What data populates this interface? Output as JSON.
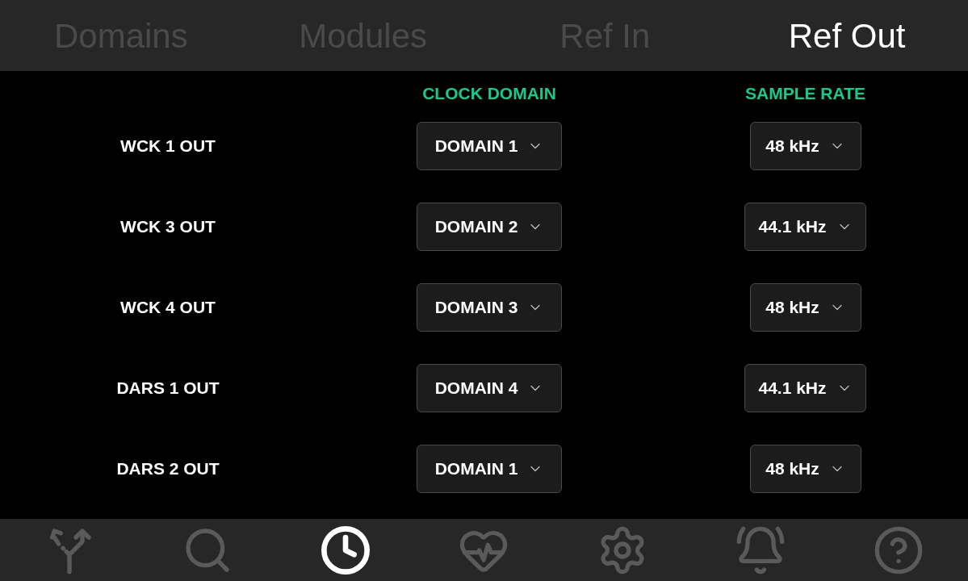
{
  "tabs": [
    {
      "label": "Domains",
      "selected": false
    },
    {
      "label": "Modules",
      "selected": false
    },
    {
      "label": "Ref In",
      "selected": false
    },
    {
      "label": "Ref Out",
      "selected": true
    }
  ],
  "table": {
    "columns": [
      "CLOCK DOMAIN",
      "SAMPLE RATE"
    ],
    "rows": [
      {
        "label": "WCK 1 OUT",
        "clock_domain": "DOMAIN 1",
        "sample_rate": "48 kHz"
      },
      {
        "label": "WCK 3 OUT",
        "clock_domain": "DOMAIN 2",
        "sample_rate": "44.1 kHz"
      },
      {
        "label": "WCK 4 OUT",
        "clock_domain": "DOMAIN 3",
        "sample_rate": "48 kHz"
      },
      {
        "label": "DARS 1 OUT",
        "clock_domain": "DOMAIN 4",
        "sample_rate": "44.1 kHz"
      },
      {
        "label": "DARS 2 OUT",
        "clock_domain": "DOMAIN 1",
        "sample_rate": "48 kHz"
      }
    ]
  },
  "nav": [
    {
      "kind": "routing",
      "selected": false
    },
    {
      "kind": "search",
      "selected": false
    },
    {
      "kind": "clock",
      "selected": true
    },
    {
      "kind": "health",
      "selected": false
    },
    {
      "kind": "settings",
      "selected": false
    },
    {
      "kind": "alarms",
      "selected": false
    },
    {
      "kind": "help",
      "selected": false
    }
  ]
}
